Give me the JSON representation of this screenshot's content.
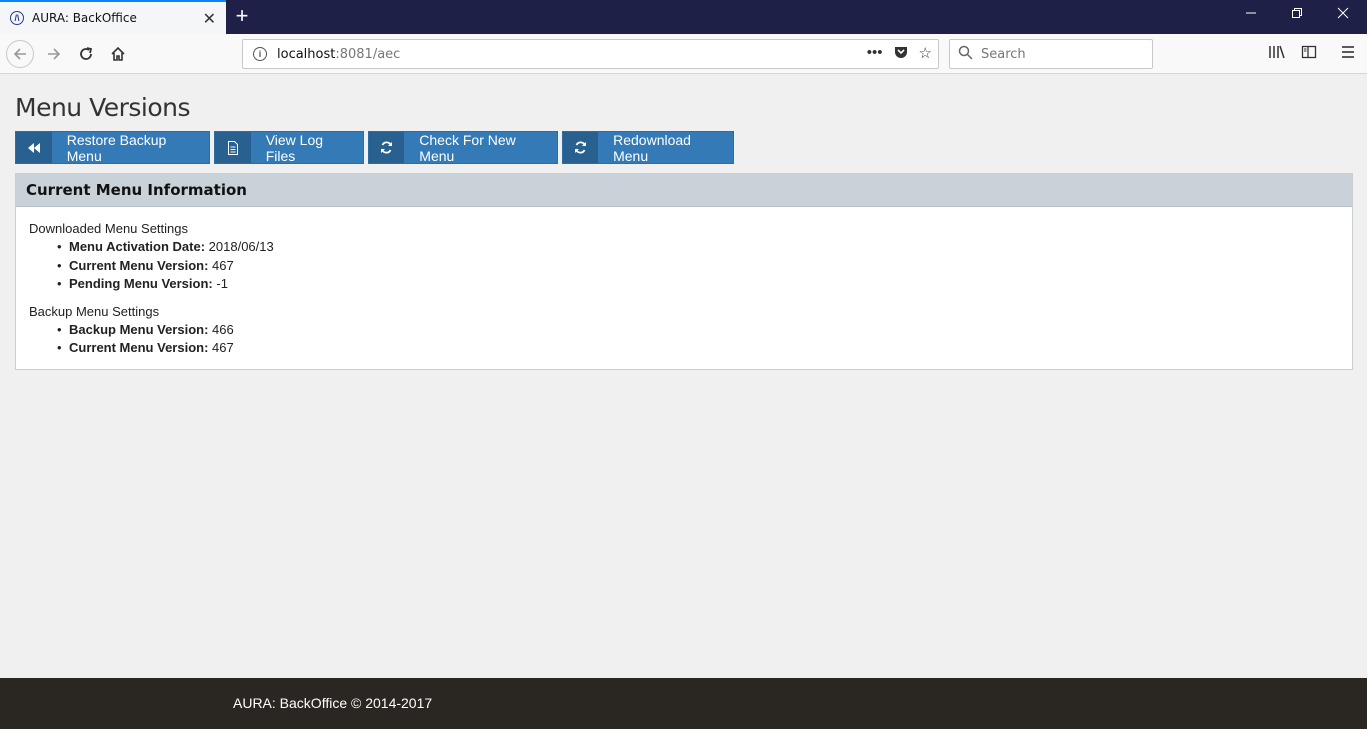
{
  "browser": {
    "tab_title": "AURA: BackOffice",
    "favicon_letter": "/\\",
    "url_host": "localhost",
    "url_rest": ":8081/aec",
    "search_placeholder": "Search",
    "new_tab_symbol": "+",
    "tab_close_symbol": "✕"
  },
  "page": {
    "title": "Menu Versions",
    "buttons": [
      {
        "label": "Restore Backup Menu",
        "icon": "rewind-icon",
        "glyph": "◀◀"
      },
      {
        "label": "View Log Files",
        "icon": "file-icon",
        "glyph": "🗎"
      },
      {
        "label": "Check For New Menu",
        "icon": "refresh-icon",
        "glyph": "⟳"
      },
      {
        "label": "Redownload Menu",
        "icon": "refresh-icon",
        "glyph": "⟳"
      }
    ],
    "panel": {
      "heading": "Current Menu Information",
      "downloaded": {
        "title": "Downloaded Menu Settings",
        "items": [
          {
            "label": "Menu Activation Date:",
            "value": "2018/06/13"
          },
          {
            "label": "Current Menu Version:",
            "value": "467"
          },
          {
            "label": "Pending Menu Version:",
            "value": "-1"
          }
        ]
      },
      "backup": {
        "title": "Backup Menu Settings",
        "items": [
          {
            "label": "Backup Menu Version:",
            "value": "466"
          },
          {
            "label": "Current Menu Version:",
            "value": "467"
          }
        ]
      }
    }
  },
  "footer": {
    "text": "AURA: BackOffice © 2014-2017"
  },
  "colors": {
    "primary": "#337ab7",
    "primary_dark": "#286090",
    "panel_heading": "#c9d2d8",
    "footer": "#2a2622",
    "titlebar": "#1f2048"
  }
}
